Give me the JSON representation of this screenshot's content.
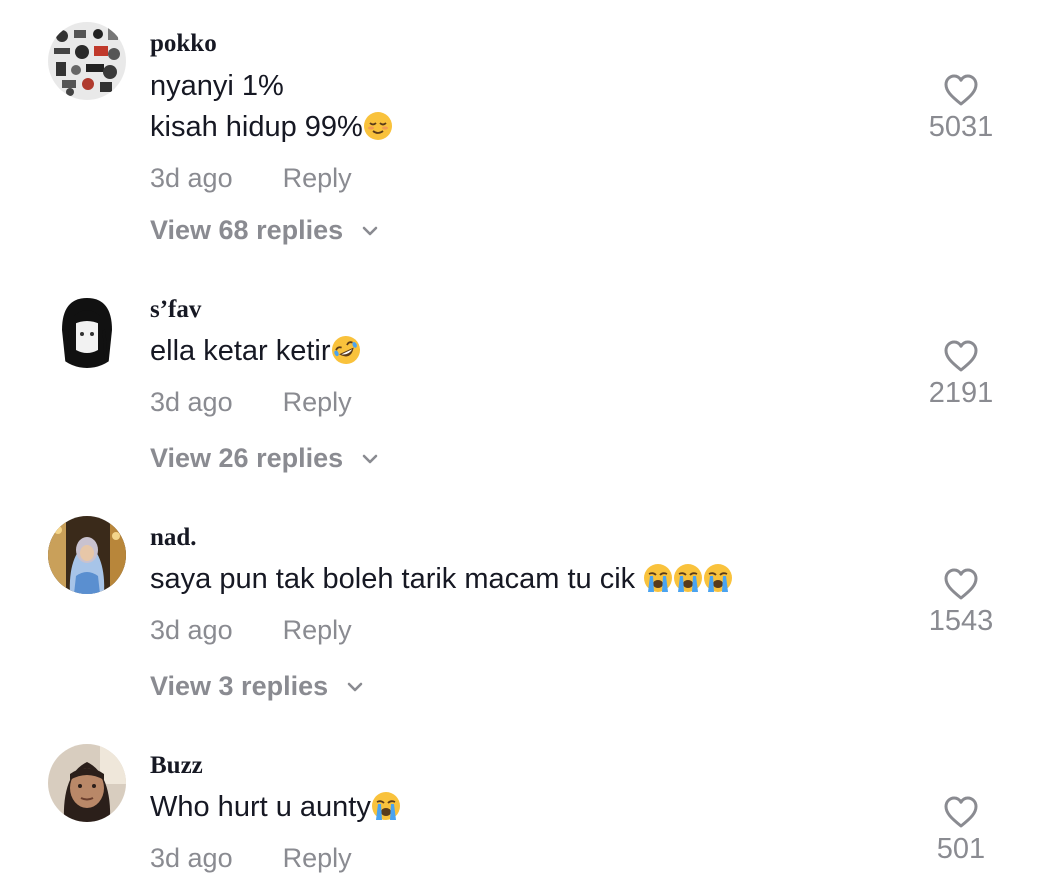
{
  "comments": [
    {
      "username": "pokko",
      "lines": [
        "nyanyi 1%",
        "kisah hidup 99%"
      ],
      "emoji": [
        "relieved-face"
      ],
      "time": "3d ago",
      "reply_label": "Reply",
      "view_replies": "View 68 replies",
      "likes": "5031"
    },
    {
      "username": "s’fav",
      "lines": [
        "ella ketar ketir"
      ],
      "emoji": [
        "rolling-on-floor-laughing-face"
      ],
      "time": "3d ago",
      "reply_label": "Reply",
      "view_replies": "View 26 replies",
      "likes": "2191"
    },
    {
      "username": "nad.",
      "lines": [
        "saya pun tak boleh tarik macam tu cik "
      ],
      "emoji": [
        "loudly-crying-face",
        "loudly-crying-face",
        "loudly-crying-face"
      ],
      "time": "3d ago",
      "reply_label": "Reply",
      "view_replies": "View 3 replies",
      "likes": "1543"
    },
    {
      "username": "Buzz",
      "lines": [
        "Who hurt u aunty"
      ],
      "emoji": [
        "loudly-crying-face"
      ],
      "time": "3d ago",
      "reply_label": "Reply",
      "likes": "501"
    }
  ],
  "icons": {
    "like": "heart-outline-icon",
    "expand": "chevron-down-icon"
  },
  "colors": {
    "text": "#161823",
    "muted": "#8a8b91",
    "emoji_yellow": "#f9c23c",
    "tear_blue": "#4aa3f0"
  }
}
